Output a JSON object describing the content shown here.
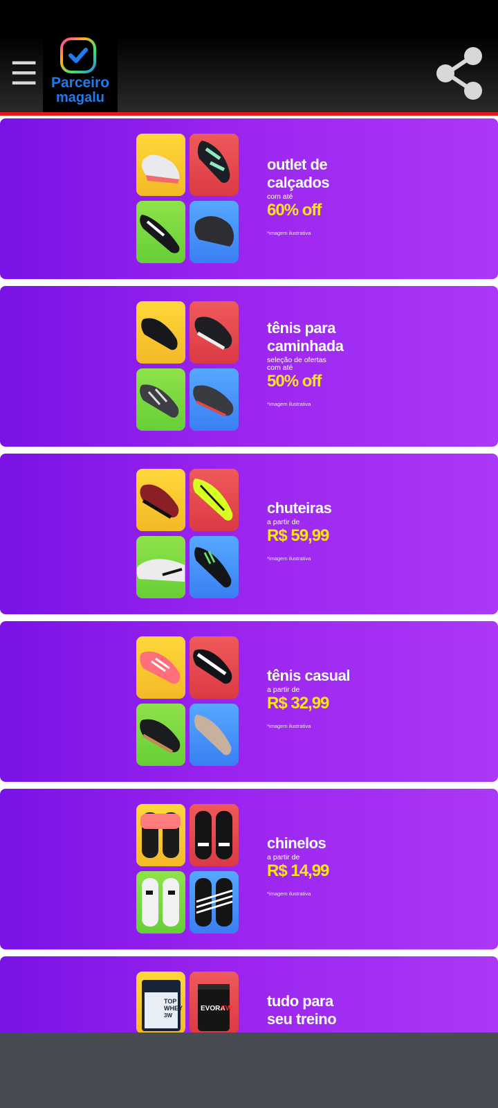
{
  "header": {
    "menu_icon": "hamburger-menu-icon",
    "logo_line1": "Parceiro",
    "logo_line2": "magalu",
    "share_icon": "share-icon",
    "accent": "#e61a1a"
  },
  "cards": [
    {
      "title1": "outlet de",
      "title2": "calçados",
      "sub1": "com até",
      "sub2": "",
      "price": "60% off",
      "fine": "*imagem ilustrativa"
    },
    {
      "title1": "tênis para",
      "title2": "caminhada",
      "sub1": "seleção de ofertas",
      "sub2": "com até",
      "price": "50% off",
      "fine": "*imagem ilustrativa"
    },
    {
      "title1": "chuteiras",
      "title2": "",
      "sub1": "a partir de",
      "sub2": "",
      "price": "R$ 59,99",
      "fine": "*imagem ilustrativa"
    },
    {
      "title1": "tênis casual",
      "title2": "",
      "sub1": "a partir de",
      "sub2": "",
      "price": "R$ 32,99",
      "fine": "*imagem ilustrativa"
    },
    {
      "title1": "chinelos",
      "title2": "",
      "sub1": "a partir de",
      "sub2": "",
      "price": "R$ 14,99",
      "fine": "*imagem ilustrativa"
    },
    {
      "title1": "tudo para",
      "title2": "seu treino",
      "sub1": "",
      "sub2": "",
      "price": "",
      "fine": "",
      "product1_brand": "TOP",
      "product1_name": "WHEY",
      "product1_tag": "3W",
      "product2_name": "EVORA",
      "product2_tag": "FW"
    }
  ],
  "colors": {
    "card_start": "#7a12e6",
    "card_end": "#ab38f7",
    "price": "#ffe41a"
  }
}
